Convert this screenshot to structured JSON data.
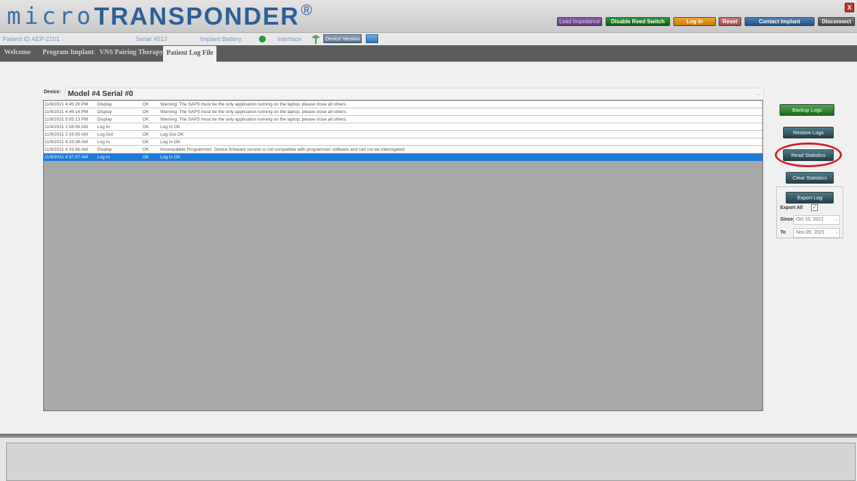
{
  "app": {
    "logo_micro": "micro",
    "logo_transponder": "TRANSPONDER",
    "logo_registered": "®"
  },
  "toolbar": {
    "lead_impedance": "Lead Impedance",
    "disable_reed_switch": "Disable Reed Switch",
    "log_in": "Log In",
    "reset": "Reset",
    "contact_implant": "Contact Implant",
    "disconnect": "Disconnect",
    "close": "X"
  },
  "info": {
    "patient_id_label": "Patient ID",
    "patient_id_value": "AEP-2101",
    "serial_label": "Serial",
    "serial_value": "#513",
    "implant_battery_label": "Implant Battery",
    "interface_label": "Interface",
    "device_version_button": "Device Version"
  },
  "tabs": [
    {
      "label": "Welcome",
      "active": false
    },
    {
      "label": "Program Implant",
      "active": false
    },
    {
      "label": "VNS Pairing Therapy",
      "active": false
    },
    {
      "label": "Patient Log File",
      "active": true
    }
  ],
  "device": {
    "label": "Device:",
    "value": "Model #4 Serial #0"
  },
  "log_rows": [
    {
      "date": "11/8/2021 4:45:26 PM",
      "action": "Display",
      "status": "OK",
      "message": "Warning: The SAPS must be the only application running on the laptop, please close all others.",
      "selected": false
    },
    {
      "date": "11/8/2021 4:46:14 PM",
      "action": "Display",
      "status": "OK",
      "message": "Warning: The SAPS must be the only application running on the laptop, please close all others.",
      "selected": false
    },
    {
      "date": "11/8/2021 5:05:13 PM",
      "action": "Display",
      "status": "OK",
      "message": "Warning: The SAPS must be the only application running on the laptop, please close all others.",
      "selected": false
    },
    {
      "date": "11/9/2021 1:58:06 AM",
      "action": "Log In",
      "status": "OK",
      "message": "Log In OK",
      "selected": false
    },
    {
      "date": "11/9/2021 2:16:09 AM",
      "action": "Log Out",
      "status": "OK",
      "message": "Log Out OK",
      "selected": false
    },
    {
      "date": "11/9/2021 4:33:38 AM",
      "action": "Log In",
      "status": "OK",
      "message": "Log In OK",
      "selected": false
    },
    {
      "date": "11/9/2021 4:33:56 AM",
      "action": "Display",
      "status": "OK",
      "message": "Incompatible Programmer: Device firmware version is not compatible with programmer software and can not be interrogated",
      "selected": false
    },
    {
      "date": "11/9/2021 4:37:07 AM",
      "action": "Log In",
      "status": "OK",
      "message": "Log In OK",
      "selected": true
    }
  ],
  "actions": {
    "backup_logs": "Backup Logs",
    "restore_logs": "Restore Logs",
    "read_statistics": "Read Statistics",
    "clear_statistics": "Clear Statistics",
    "export_log": "Export Log",
    "export_all_label": "Export All",
    "export_all_checked": true,
    "since_label": "Since",
    "since_value": "Oct 10, 2021",
    "to_label": "To",
    "to_value": "Nov 09, 2021"
  },
  "colors": {
    "accent_blue": "#2f5f98",
    "selected_row": "#1e7ad6",
    "highlight_ring": "#d31f25"
  }
}
